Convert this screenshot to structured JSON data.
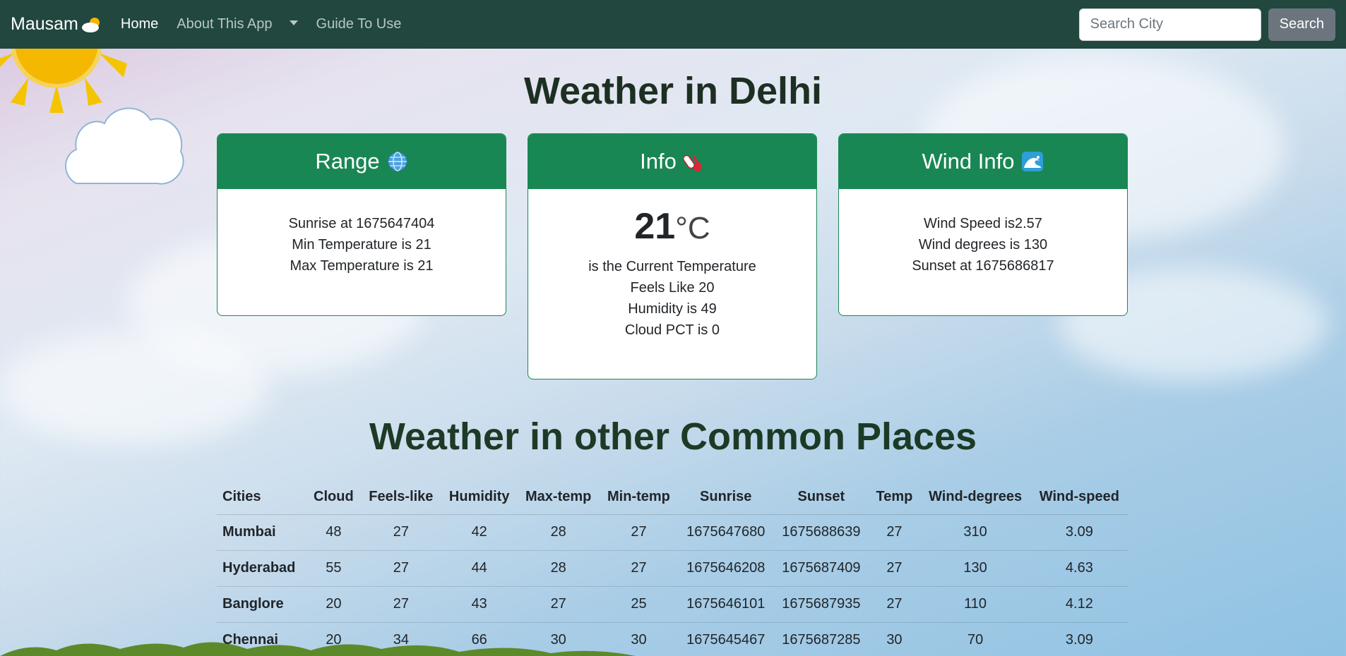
{
  "navbar": {
    "brand": "Mausam",
    "links": [
      {
        "label": "Home",
        "active": true
      },
      {
        "label": "About This App",
        "active": false
      },
      {
        "label": "Guide To Use",
        "active": false
      }
    ],
    "search": {
      "placeholder": "Search City",
      "value": "",
      "button": "Search"
    }
  },
  "title": "Weather in Delhi",
  "cards": {
    "range": {
      "header": "Range",
      "icon": "globe-icon",
      "lines": [
        "Sunrise at 1675647404",
        "Min Temperature is 21",
        "Max Temperature is 21"
      ]
    },
    "info": {
      "header": "Info",
      "icon": "thermometer-icon",
      "temp": "21",
      "unit": "°C",
      "lines": [
        "is the Current Temperature",
        "Feels Like 20",
        "Humidity is 49",
        "Cloud PCT is 0"
      ]
    },
    "wind": {
      "header": "Wind Info",
      "icon": "wave-icon",
      "lines": [
        "Wind Speed is2.57",
        "Wind degrees is 130",
        "Sunset at 1675686817"
      ]
    }
  },
  "section_title": "Weather in other Common Places",
  "table": {
    "headers": [
      "Cities",
      "Cloud",
      "Feels-like",
      "Humidity",
      "Max-temp",
      "Min-temp",
      "Sunrise",
      "Sunset",
      "Temp",
      "Wind-degrees",
      "Wind-speed"
    ],
    "rows": [
      [
        "Mumbai",
        "48",
        "27",
        "42",
        "28",
        "27",
        "1675647680",
        "1675688639",
        "27",
        "310",
        "3.09"
      ],
      [
        "Hyderabad",
        "55",
        "27",
        "44",
        "28",
        "27",
        "1675646208",
        "1675687409",
        "27",
        "130",
        "4.63"
      ],
      [
        "Banglore",
        "20",
        "27",
        "43",
        "27",
        "25",
        "1675646101",
        "1675687935",
        "27",
        "110",
        "4.12"
      ],
      [
        "Chennai",
        "20",
        "34",
        "66",
        "30",
        "30",
        "1675645467",
        "1675687285",
        "30",
        "70",
        "3.09"
      ]
    ]
  },
  "colors": {
    "navbar": "#21473f",
    "card_header": "#198754",
    "search_button": "#6c757d"
  }
}
